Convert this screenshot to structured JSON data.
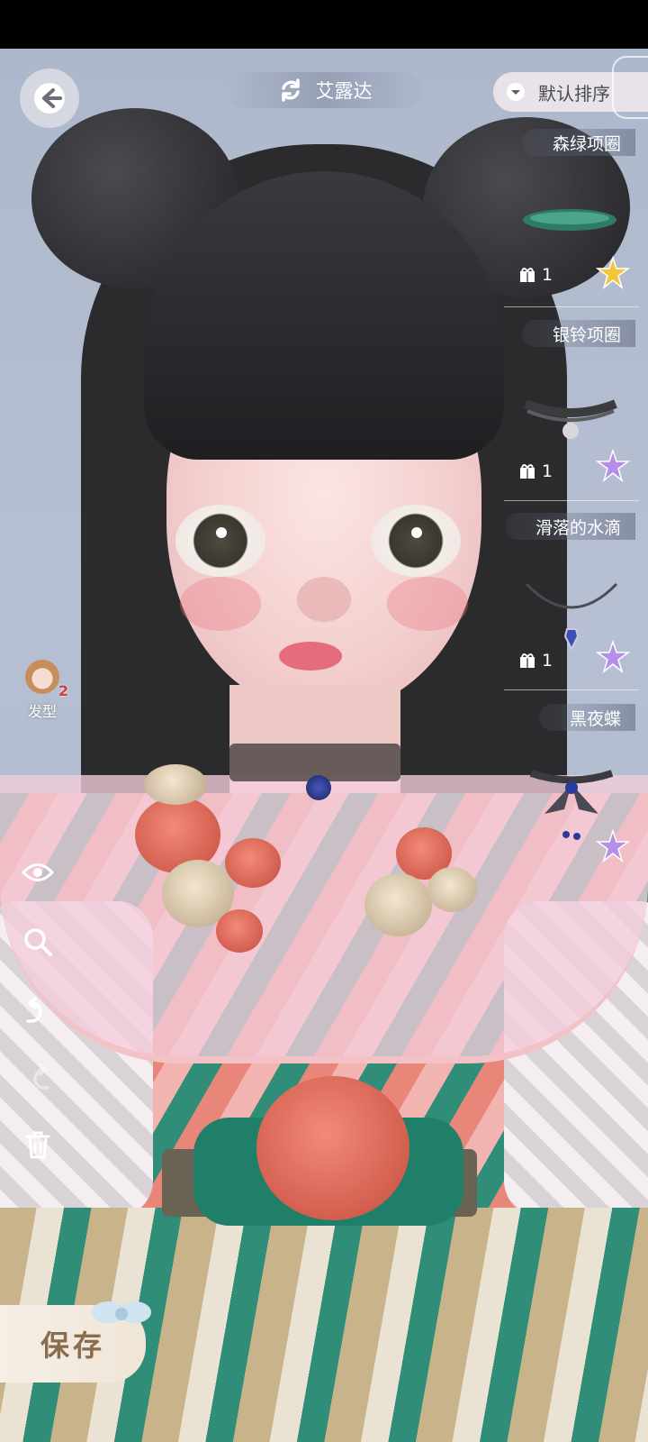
{
  "header": {
    "character_name": "艾露达",
    "sort_label": "默认排序"
  },
  "items": [
    {
      "name": "森绿项圈",
      "count": "1",
      "star_color": "#f2c53a",
      "thumb": "green-ribbon-choker"
    },
    {
      "name": "银铃项圈",
      "count": "1",
      "star_color": "#b48ee8",
      "thumb": "silver-bell-choker"
    },
    {
      "name": "滑落的水滴",
      "count": "1",
      "star_color": "#b48ee8",
      "thumb": "water-drop-necklace"
    },
    {
      "name": "黑夜蝶",
      "count": "",
      "star_color": "#b48ee8",
      "thumb": "night-butterfly-choker"
    }
  ],
  "side_tools": {
    "hair_label": "发型",
    "hair_badge": "2",
    "tools": [
      "eye-icon",
      "zoom-icon",
      "undo-icon",
      "redo-icon",
      "trash-icon"
    ]
  },
  "save_label": "保存",
  "colors": {
    "save_text": "#8a6d4f",
    "accent_green": "#2f8d78",
    "rose": "#e8705e"
  }
}
